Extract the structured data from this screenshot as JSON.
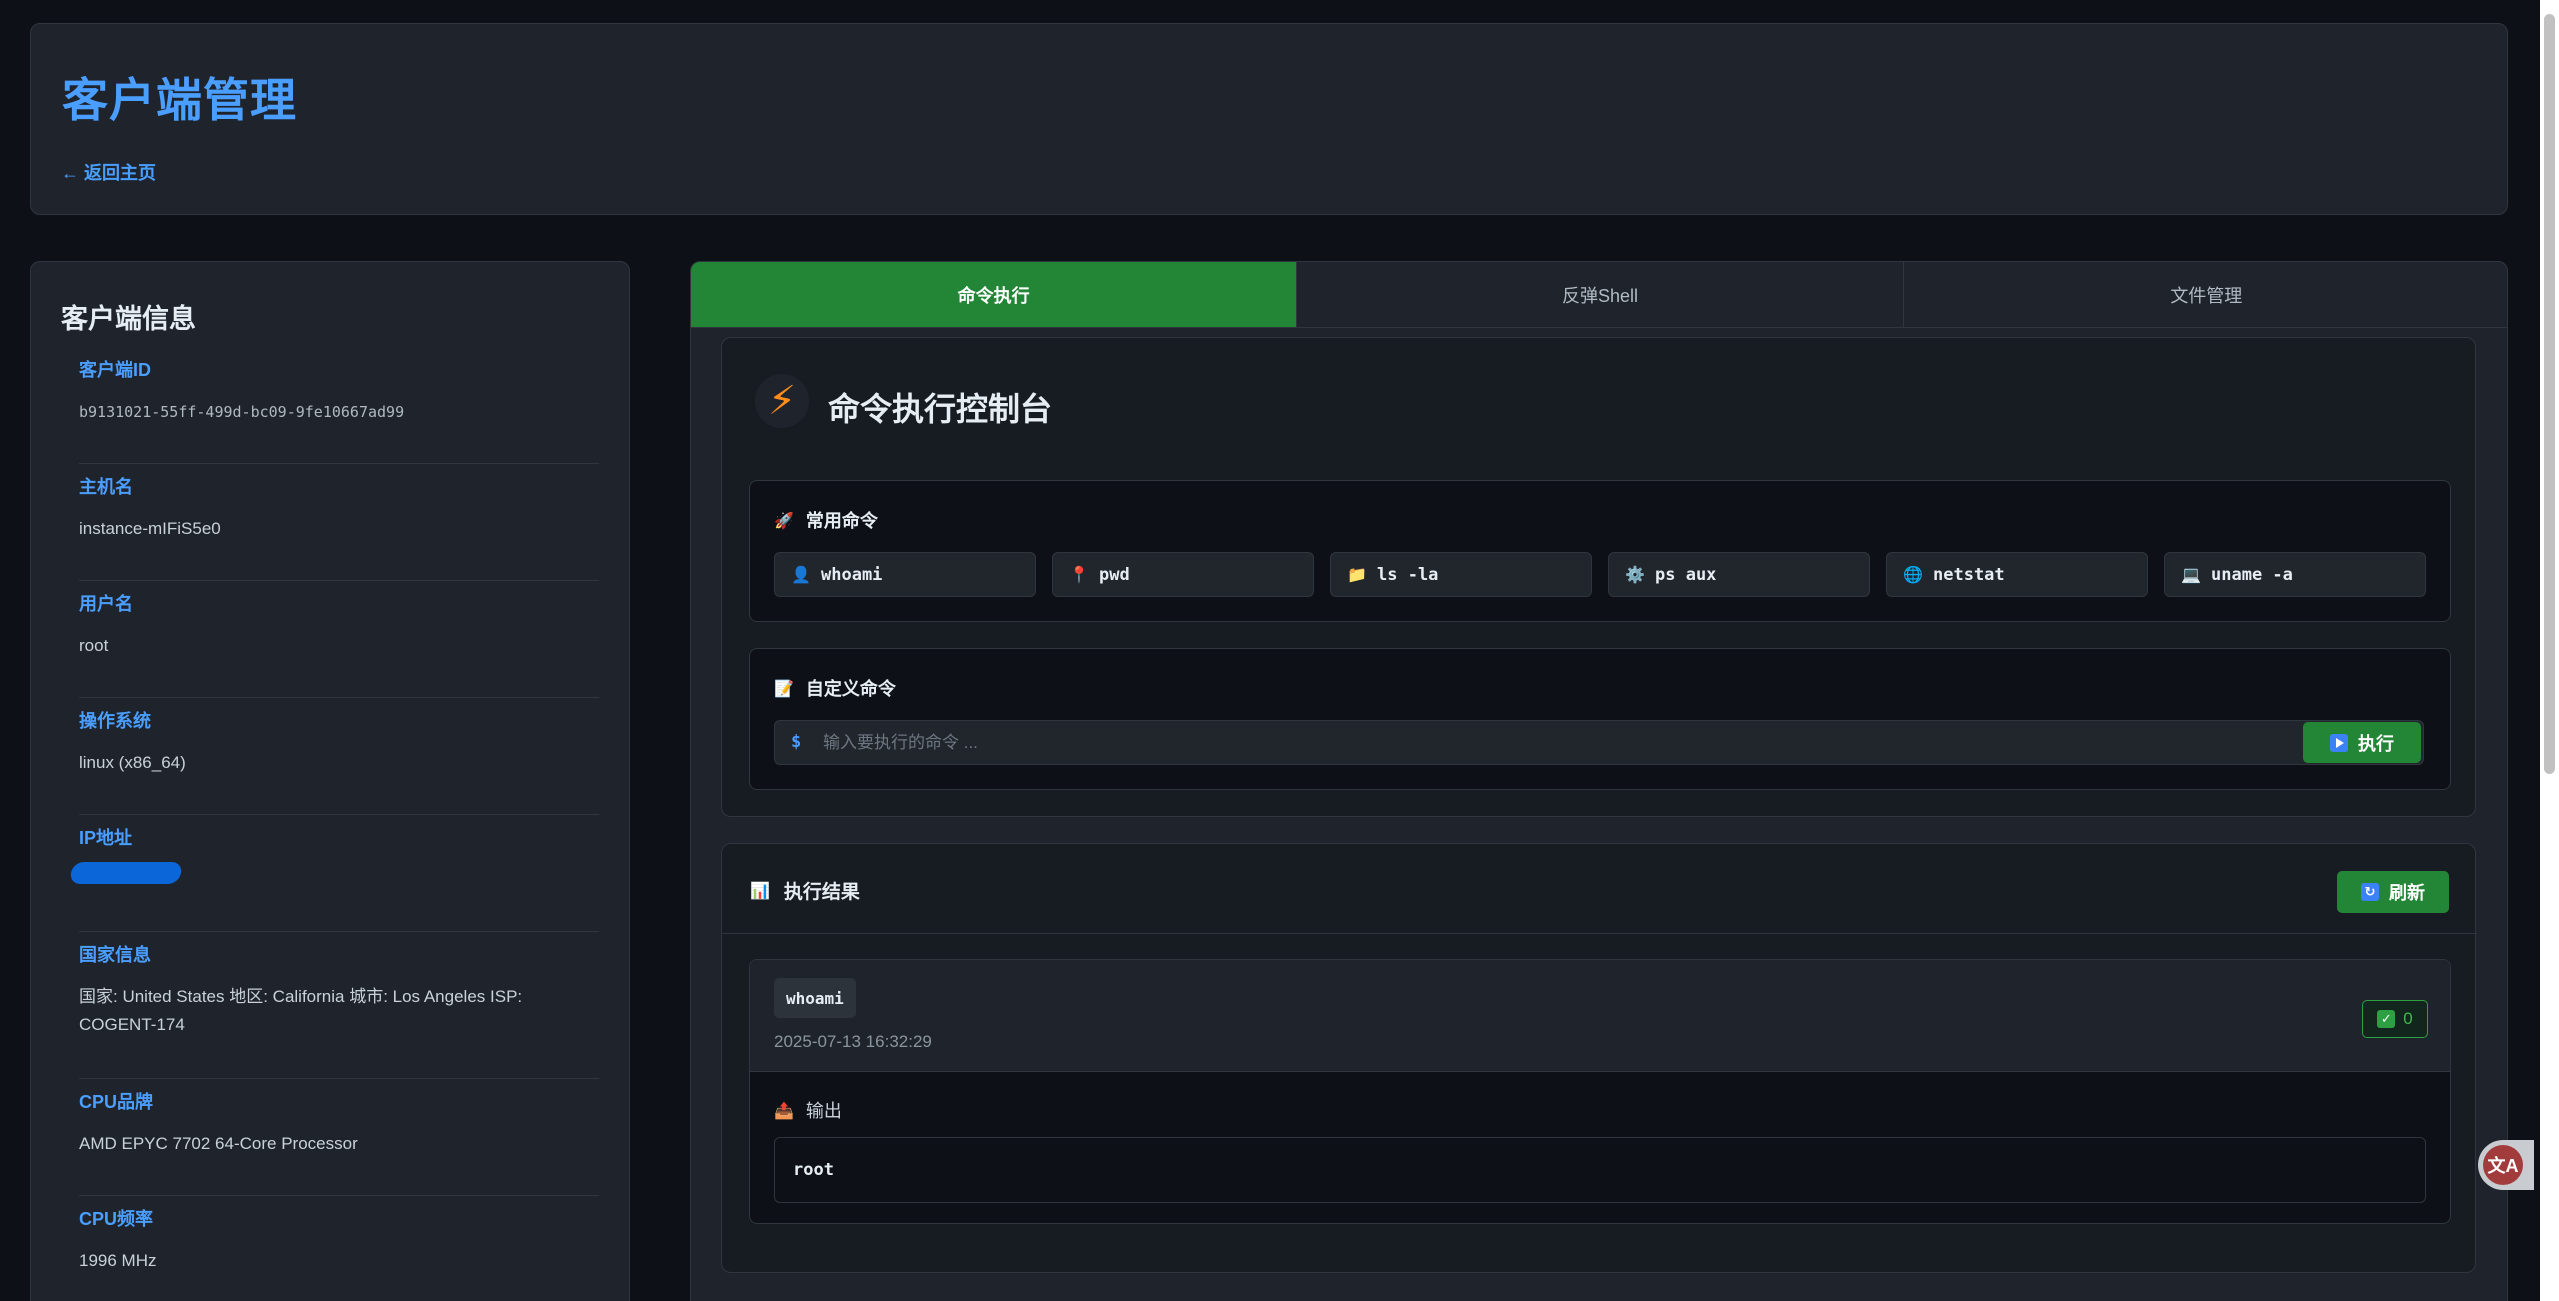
{
  "header": {
    "title": "客户端管理",
    "back_link": "← 返回主页"
  },
  "client_info": {
    "title": "客户端信息",
    "items": [
      {
        "label": "客户端ID",
        "value": "b9131021-55ff-499d-bc09-9fe10667ad99"
      },
      {
        "label": "主机名",
        "value": "instance-mIFiS5e0"
      },
      {
        "label": "用户名",
        "value": "root"
      },
      {
        "label": "操作系统",
        "value": "linux (x86_64)"
      },
      {
        "label": "IP地址",
        "value": ""
      },
      {
        "label": "国家信息",
        "value": "国家: United States 地区: California 城市: Los Angeles ISP: COGENT-174"
      },
      {
        "label": "CPU品牌",
        "value": "AMD EPYC 7702 64-Core Processor"
      },
      {
        "label": "CPU频率",
        "value": "1996 MHz"
      }
    ]
  },
  "tabs": [
    {
      "label": "命令执行",
      "active": true
    },
    {
      "label": "反弹Shell",
      "active": false
    },
    {
      "label": "文件管理",
      "active": false
    }
  ],
  "console": {
    "title": "命令执行控制台",
    "bolt_icon": "⚡",
    "common_commands": {
      "title": "常用命令",
      "icon": "🚀",
      "commands": [
        {
          "icon": "👤",
          "label": "whoami"
        },
        {
          "icon": "📍",
          "label": "pwd"
        },
        {
          "icon": "📁",
          "label": "ls -la"
        },
        {
          "icon": "⚙️",
          "label": "ps aux"
        },
        {
          "icon": "🌐",
          "label": "netstat"
        },
        {
          "icon": "💻",
          "label": "uname -a"
        }
      ]
    },
    "custom_command": {
      "title": "自定义命令",
      "icon": "📝",
      "prompt": "$",
      "placeholder": "输入要执行的命令 ...",
      "value": "",
      "execute_label": "执行"
    }
  },
  "results": {
    "title": "执行结果",
    "icon": "📊",
    "refresh_label": "刷新",
    "refresh_icon": "↻",
    "entries": [
      {
        "command": "whoami",
        "timestamp": "2025-07-13 16:32:29",
        "exit_code": "0",
        "output_label": "输出",
        "output_icon": "📤",
        "output": "root"
      }
    ]
  },
  "floating_translate": {
    "label": "文A"
  },
  "colors": {
    "accent": "#4a9eff",
    "success": "#238636",
    "background": "#0d1117",
    "panel": "#1f242c"
  }
}
